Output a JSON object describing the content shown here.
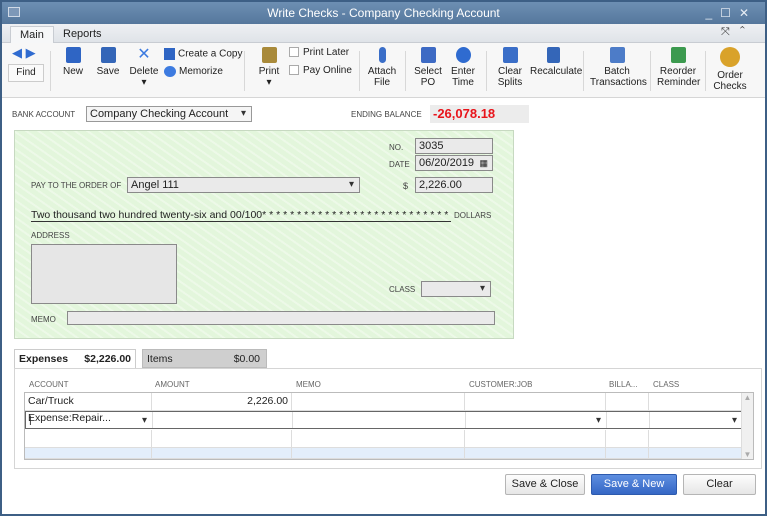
{
  "window": {
    "title": "Write Checks - Company Checking Account"
  },
  "tabs": [
    {
      "label": "Main"
    },
    {
      "label": "Reports"
    }
  ],
  "toolbar": {
    "find": "Find",
    "new": "New",
    "save": "Save",
    "delete": "Delete",
    "create_copy": "Create a Copy",
    "memorize": "Memorize",
    "print": "Print",
    "print_later": "Print Later",
    "pay_online": "Pay Online",
    "attach_file": "Attach File",
    "select_po": "Select PO",
    "enter_time": "Enter Time",
    "clear_splits": "Clear Splits",
    "recalculate": "Recalculate",
    "batch_transactions": "Batch Transactions",
    "reorder_reminder": "Reorder Reminder",
    "order_checks": "Order Checks"
  },
  "bank": {
    "label": "Bank Account",
    "value": "Company Checking Account",
    "ending_balance_label": "Ending Balance",
    "ending_balance": "-26,078.18"
  },
  "check": {
    "no_label": "No.",
    "no": "3035",
    "date_label": "Date",
    "date": "06/20/2019",
    "pay_to_label": "Pay to the Order of",
    "payee": "Angel 111",
    "amount_symbol": "$",
    "amount": "2,226.00",
    "written_amount": "Two thousand two hundred twenty-six and 00/100* * * * * * * * * * * * * * * * * * * * * * * * * * * * * * *",
    "dollars_label": "Dollars",
    "address_label": "Address",
    "class_label": "Class",
    "memo_label": "Memo"
  },
  "split_tabs": {
    "expenses_label": "Expenses",
    "expenses_total": "$2,226.00",
    "items_label": "Items",
    "items_total": "$0.00"
  },
  "grid": {
    "headers": [
      "ACCOUNT",
      "AMOUNT",
      "MEMO",
      "CUSTOMER:JOB",
      "BILLA...",
      "CLASS"
    ],
    "rows": [
      {
        "account": "Car/Truck Expense:Repair...",
        "amount": "2,226.00"
      }
    ]
  },
  "buttons": {
    "save_close": "Save & Close",
    "save_new": "Save & New",
    "clear": "Clear"
  },
  "colors": {
    "balance": "#e8141b",
    "primary": "#3a6bc8"
  }
}
